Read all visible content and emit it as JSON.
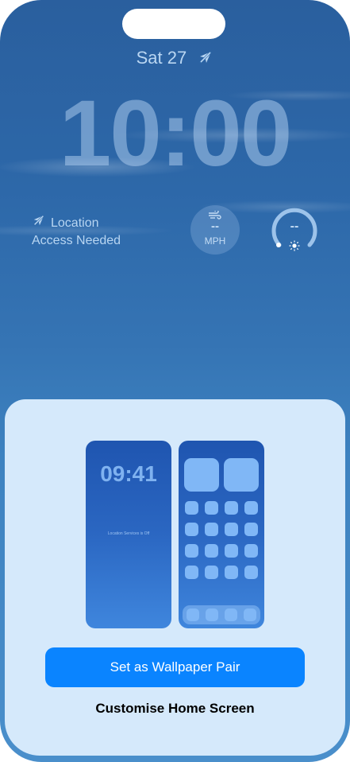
{
  "lock_screen": {
    "date": "Sat 27",
    "time": "10:00",
    "location_widget": {
      "line1": "Location",
      "line2": "Access Needed"
    },
    "wind_widget": {
      "value": "--",
      "unit": "MPH"
    },
    "uv_widget": {
      "value": "--"
    }
  },
  "sheet": {
    "preview_lock_time": "09:41",
    "preview_lock_note": "Location Services is Off",
    "primary_button": "Set as Wallpaper Pair",
    "secondary_button": "Customise Home Screen"
  },
  "colors": {
    "accent": "#0a84ff",
    "sheet_background": "#d5e9fb",
    "wallpaper_top": "#2a5f9e",
    "wallpaper_bottom": "#4a8fcb"
  },
  "icons": [
    "location-off-icon",
    "wind-icon",
    "sun-icon"
  ]
}
